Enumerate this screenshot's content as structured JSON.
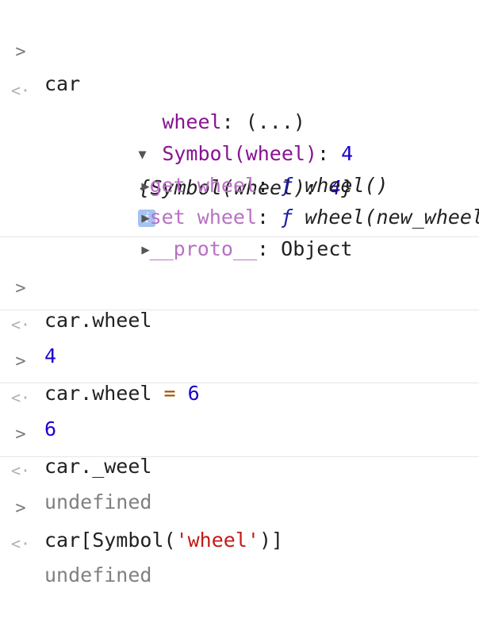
{
  "glyphs": {
    "input_chevron": ">",
    "output_chevron": "<·",
    "expanded": "▼",
    "collapsed": "▶"
  },
  "entries": {
    "e1": {
      "input": "car",
      "preview": {
        "open": "{",
        "key": "Symbol(wheel)",
        "colon": ": ",
        "value": "4",
        "close": "}"
      },
      "info_icon": "i",
      "props": {
        "p1": {
          "key": "wheel",
          "colon": ": ",
          "value": "(...)"
        },
        "p2": {
          "key": "Symbol(wheel)",
          "colon": ": ",
          "value": "4"
        },
        "p3": {
          "key": "get wheel",
          "colon": ": ",
          "f": "ƒ",
          "value": " wheel()"
        },
        "p4": {
          "key": "set wheel",
          "colon": ": ",
          "f": "ƒ",
          "value": " wheel(new_wheel)"
        },
        "p5": {
          "key": "__proto__",
          "colon": ": ",
          "value": "Object"
        }
      }
    },
    "e2": {
      "input": "car.wheel",
      "output": "4"
    },
    "e3": {
      "input_lhs": "car.wheel",
      "input_op": " = ",
      "input_rhs": "6",
      "output": "6"
    },
    "e4": {
      "input": "car._weel",
      "output": "undefined"
    },
    "e5": {
      "input_pre": "car[Symbol(",
      "input_str": "'wheel'",
      "input_post": ")]",
      "output": "undefined"
    }
  },
  "colors": {
    "property_key": "#881391",
    "accessor_key": "#b871c4",
    "number": "#1c00cf",
    "string": "#c41a16",
    "undefined": "#808080",
    "operator": "#a04f00",
    "info_badge": "#a7c2f2"
  }
}
